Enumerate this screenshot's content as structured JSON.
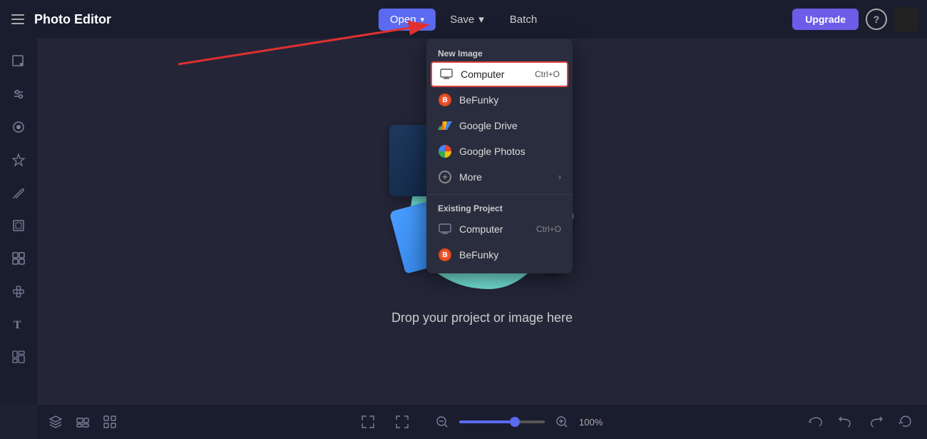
{
  "app": {
    "title": "Photo Editor"
  },
  "topbar": {
    "open_label": "Open",
    "open_chevron": "▾",
    "save_label": "Save",
    "save_chevron": "▾",
    "batch_label": "Batch",
    "upgrade_label": "Upgrade",
    "help_label": "?"
  },
  "dropdown": {
    "new_image_section": "New Image",
    "existing_project_section": "Existing Project",
    "items_new": [
      {
        "id": "computer-new",
        "label": "Computer",
        "shortcut": "Ctrl+O",
        "icon": "monitor",
        "highlighted": true
      },
      {
        "id": "befunky-new",
        "label": "BeFunky",
        "shortcut": "",
        "icon": "befunky",
        "highlighted": false
      },
      {
        "id": "gdrive-new",
        "label": "Google Drive",
        "shortcut": "",
        "icon": "gdrive",
        "highlighted": false
      },
      {
        "id": "gphotos-new",
        "label": "Google Photos",
        "shortcut": "",
        "icon": "gphotos",
        "highlighted": false
      },
      {
        "id": "more-new",
        "label": "More",
        "shortcut": "",
        "icon": "plus",
        "highlighted": false,
        "has_arrow": true
      }
    ],
    "items_existing": [
      {
        "id": "computer-existing",
        "label": "Computer",
        "shortcut": "Ctrl+O",
        "icon": "monitor",
        "highlighted": false
      },
      {
        "id": "befunky-existing",
        "label": "BeFunky",
        "shortcut": "",
        "icon": "befunky",
        "highlighted": false
      }
    ]
  },
  "canvas": {
    "drop_text": "Drop your project or image here"
  },
  "bottombar": {
    "zoom_percent": "100%",
    "zoom_value": 65
  },
  "sidebar": {
    "items": [
      {
        "id": "crop",
        "icon": "⊡"
      },
      {
        "id": "adjustments",
        "icon": "⚙"
      },
      {
        "id": "effects",
        "icon": "👁"
      },
      {
        "id": "ai",
        "icon": "✦"
      },
      {
        "id": "retouch",
        "icon": "🖊"
      },
      {
        "id": "frames",
        "icon": "▭"
      },
      {
        "id": "overlays",
        "icon": "⊞"
      },
      {
        "id": "graphics",
        "icon": "⬡"
      },
      {
        "id": "text",
        "icon": "T"
      },
      {
        "id": "collage",
        "icon": "⊠"
      }
    ]
  }
}
